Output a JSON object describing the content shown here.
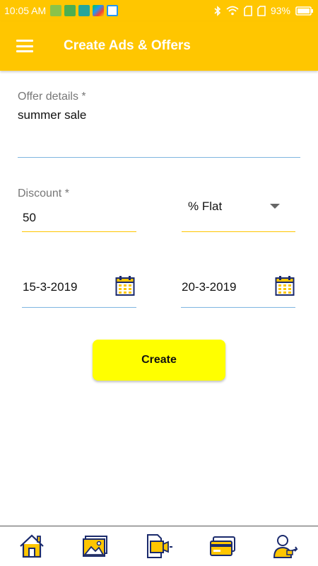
{
  "status_bar": {
    "time": "10:05 AM",
    "battery": "93%"
  },
  "app_bar": {
    "title": "Create Ads & Offers",
    "menu_icon": "menu-icon"
  },
  "form": {
    "offer_details": {
      "label": "Offer details *",
      "value": "summer sale"
    },
    "discount": {
      "label": "Discount *",
      "value": "50"
    },
    "discount_type": {
      "selected": "% Flat"
    },
    "start_date": {
      "value": "15-3-2019"
    },
    "end_date": {
      "value": "20-3-2019"
    }
  },
  "create_button": {
    "label": "Create"
  },
  "bottom_nav": {
    "items": [
      "home-icon",
      "gallery-icon",
      "ads-icon",
      "payment-card-icon",
      "profile-icon"
    ]
  },
  "colors": {
    "accent": "#FFC600",
    "button": "#FFFF00",
    "underline_active": "#FFC600",
    "underline_blue": "#7FB5E0",
    "icon_blue": "#1A2A6C"
  }
}
